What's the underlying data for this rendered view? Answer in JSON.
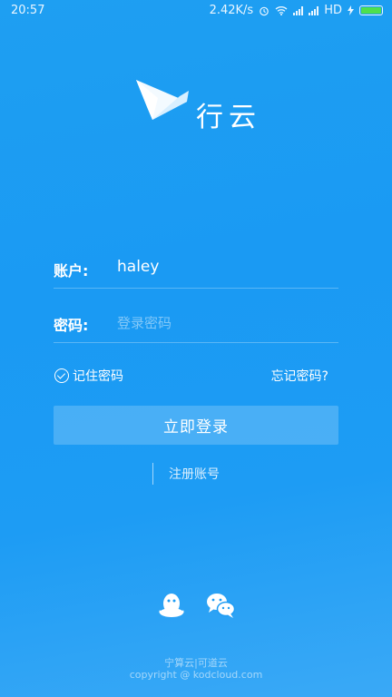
{
  "status": {
    "time": "20:57",
    "network_speed": "2.42K/s",
    "network_type": "HD",
    "icons": [
      "alarm-icon",
      "wifi-icon",
      "signal-icon",
      "charging-icon",
      "battery-icon"
    ]
  },
  "brand": {
    "name": "行云"
  },
  "form": {
    "account_label": "账户:",
    "account_value": "haley",
    "password_label": "密码:",
    "password_placeholder": "登录密码",
    "remember_label": "记住密码",
    "forgot_label": "忘记密码?",
    "login_button": "立即登录",
    "register_link": "注册账号"
  },
  "social_icons": [
    "qq-icon",
    "wechat-icon"
  ],
  "footer": {
    "line1": "宁算云|可道云",
    "line2": "copyright @ kodcloud.com"
  },
  "colors": {
    "background": "#1d9cf4",
    "battery": "#4ee04e"
  }
}
